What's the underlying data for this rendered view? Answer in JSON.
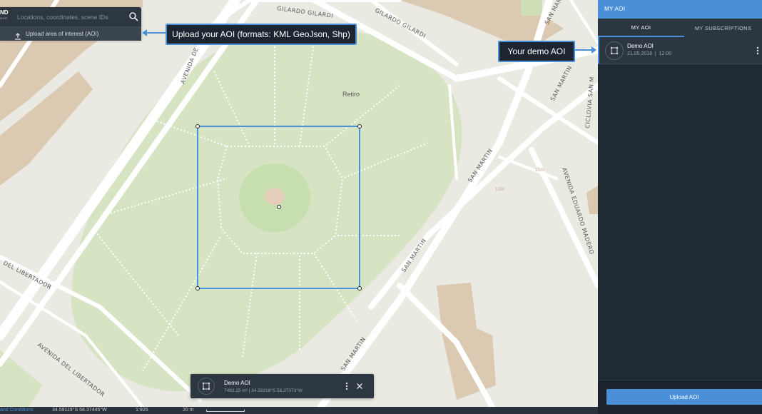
{
  "search": {
    "logo_text": "ND",
    "logo_sub": "MER",
    "placeholder": "Locations, coordinates, scene IDs",
    "upload_label": "Upload area of interest (AOI)"
  },
  "callouts": {
    "upload": "Upload your AOI (formats: KML GeoJson, Shp)",
    "demo": "Your demo AOI"
  },
  "map": {
    "streets": {
      "gilardo_1": "GILARDO GILARDI",
      "gilardo_2": "GILARDO GILARDI",
      "avenida_top": "AVENIDA DE",
      "san_martin_1": "SAN MARTIN",
      "san_martin_2": "SAN MARTIN",
      "san_martin_3": "SAN MARTIN",
      "san_martin_4": "SAN MARTIN",
      "san_martin_5": "SAN MARTIN",
      "san_martin_6": "SAN MARTIN",
      "ciclovia": "CICLOVIA SAN M",
      "eduardo_madero": "AVENIDA EDUARDO MADERO",
      "libertador_1": "DEL LIBERTADOR",
      "libertador_2": "AVENIDA DEL LIBERTADOR"
    },
    "place": "Retiro",
    "numbers": {
      "n1": "1500",
      "n2": "1200"
    }
  },
  "aoi_card": {
    "name": "Demo AOI",
    "info": "7492.15 m² | 34.59218°S 58.37373°W"
  },
  "status": {
    "terms": "and Conditions",
    "coords": "34.59119°S 58.37445°W",
    "scale_ratio": "1:925",
    "scale_distance": "20 m"
  },
  "panel": {
    "title": "MY AOI",
    "tabs": [
      "MY AOI",
      "MY SUBSCRIPTIONS"
    ],
    "items": [
      {
        "name": "Demo AOI",
        "date": "21.05.2018",
        "time": "12:00"
      }
    ],
    "upload_button": "Upload AOI"
  },
  "colors": {
    "accent": "#4a90d9",
    "panel_bg": "#1f2a33",
    "park": "#d6e4c3"
  }
}
